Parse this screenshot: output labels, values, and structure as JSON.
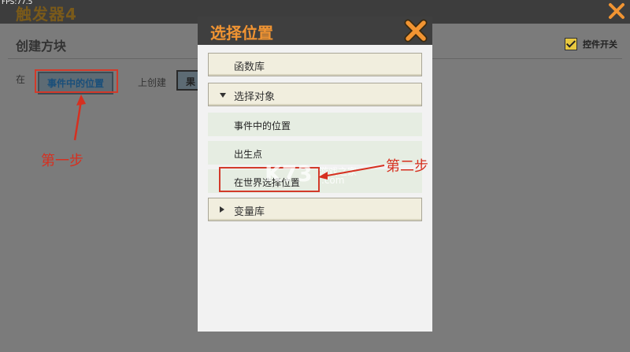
{
  "window": {
    "fps": "FPS:77.5",
    "title": "触发器4"
  },
  "editor": {
    "section_title": "创建方块",
    "toggle_label": "控件开关",
    "toggle_checked": true,
    "row_prefix": "在",
    "selected_position": "事件中的位置",
    "row_suffix": "上创建",
    "partial_button": "果"
  },
  "annotations": {
    "step1": "第一步",
    "step2": "第二步",
    "annotation_color": "#d63020"
  },
  "modal": {
    "title": "选择位置",
    "title_color": "#f19432",
    "items": [
      {
        "label": "函数库",
        "type": "header",
        "expander": "none"
      },
      {
        "label": "选择对象",
        "type": "header",
        "expander": "expanded"
      },
      {
        "label": "事件中的位置",
        "type": "option"
      },
      {
        "label": "出生点",
        "type": "option"
      },
      {
        "label": "在世界选择位置",
        "type": "option"
      },
      {
        "label": "变量库",
        "type": "header",
        "expander": "collapsed"
      }
    ]
  },
  "watermark": {
    "logo": "K73",
    "sub": "游戏之家",
    "domain": ".com"
  }
}
